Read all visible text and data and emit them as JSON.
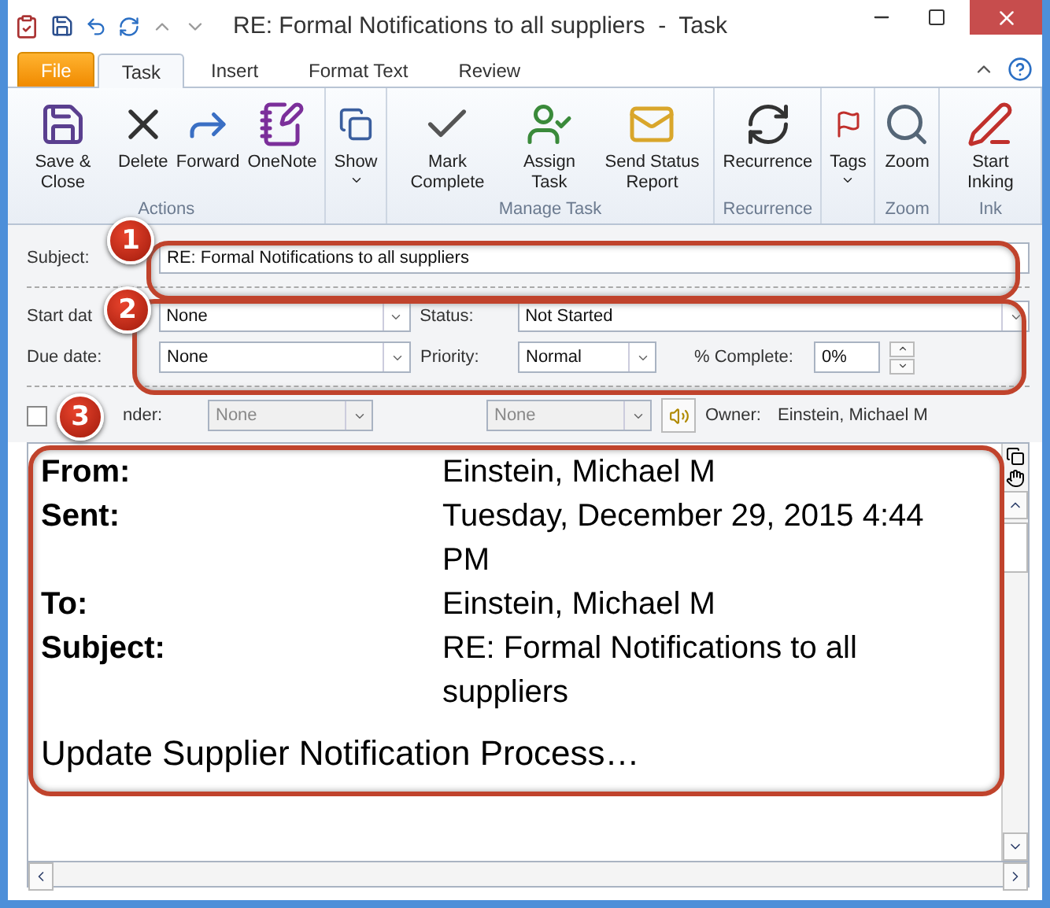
{
  "window": {
    "title": "RE: Formal Notifications to all suppliers  -  Task"
  },
  "tabs": [
    {
      "label": "File",
      "kind": "file",
      "selected": false
    },
    {
      "label": "Task",
      "kind": "tab",
      "selected": true
    },
    {
      "label": "Insert",
      "kind": "tab",
      "selected": false
    },
    {
      "label": "Format Text",
      "kind": "tab",
      "selected": false
    },
    {
      "label": "Review",
      "kind": "tab",
      "selected": false
    }
  ],
  "ribbon": [
    {
      "label": "Actions",
      "buttons": [
        {
          "label": "Save & Close"
        },
        {
          "label": "Delete"
        },
        {
          "label": "Forward"
        },
        {
          "label": "OneNote"
        }
      ]
    },
    {
      "buttons": [
        {
          "label": "Show",
          "dropdown": true
        }
      ]
    },
    {
      "label": "Manage Task",
      "buttons": [
        {
          "label": "Mark Complete"
        },
        {
          "label": "Assign Task"
        },
        {
          "label": "Send Status Report"
        }
      ]
    },
    {
      "label": "Recurrence",
      "buttons": [
        {
          "label": "Recurrence"
        }
      ]
    },
    {
      "buttons": [
        {
          "label": "Tags",
          "dropdown": true
        }
      ]
    },
    {
      "label": "Zoom",
      "buttons": [
        {
          "label": "Zoom"
        }
      ]
    },
    {
      "label": "Ink",
      "buttons": [
        {
          "label": "Start Inking"
        }
      ]
    }
  ],
  "form": {
    "subject_label": "Subject:",
    "subject": "RE: Formal Notifications to all suppliers",
    "start_label": "Start dat",
    "start": "None",
    "status_label": "Status:",
    "status": "Not Started",
    "due_label": "Due date:",
    "due": "None",
    "priority_label": "Priority:",
    "priority": "Normal",
    "complete_label": "% Complete:",
    "complete": "0%",
    "reminder_checked": false,
    "reminder_label": "nder:",
    "reminder_date": "None",
    "reminder_time": "None",
    "owner_label": "Owner:",
    "owner": "Einstein, Michael M"
  },
  "message": {
    "headers": [
      {
        "label": "From:",
        "value": "Einstein, Michael M"
      },
      {
        "label": "Sent:",
        "value": "Tuesday, December 29, 2015 4:44 PM"
      },
      {
        "label": "To:",
        "value": "Einstein, Michael M"
      },
      {
        "label": "Subject:",
        "value": "RE: Formal Notifications to all suppliers"
      }
    ],
    "body": "Update Supplier Notification Process…"
  },
  "callouts": [
    "1",
    "2",
    "3"
  ]
}
